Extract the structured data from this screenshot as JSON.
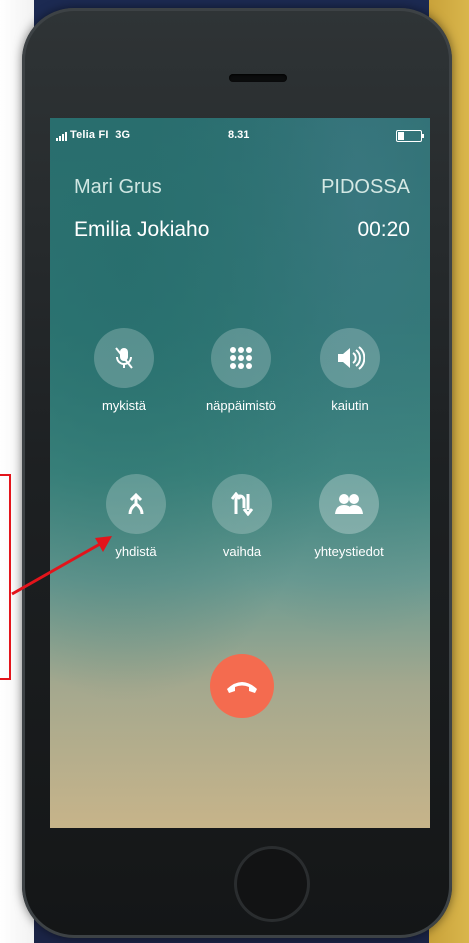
{
  "status_bar": {
    "carrier": "Telia FI",
    "network": "3G",
    "time": "8.31"
  },
  "calls": {
    "held": {
      "name": "Mari Grus",
      "status": "PIDOSSA"
    },
    "active": {
      "name": "Emilia Jokiaho",
      "duration": "00:20"
    }
  },
  "controls": [
    {
      "label": "mykistä",
      "icon": "mic-off-icon"
    },
    {
      "label": "näppäimistö",
      "icon": "keypad-icon"
    },
    {
      "label": "kaiutin",
      "icon": "speaker-icon"
    },
    {
      "label": "yhdistä",
      "icon": "merge-calls-icon"
    },
    {
      "label": "vaihda",
      "icon": "swap-calls-icon"
    },
    {
      "label": "yhteystiedot",
      "icon": "contacts-icon"
    }
  ],
  "end_call": {
    "icon": "end-call-icon",
    "color": "#f46b4f"
  },
  "annotation": {
    "color": "#e3141b",
    "target": "yhdistä"
  }
}
